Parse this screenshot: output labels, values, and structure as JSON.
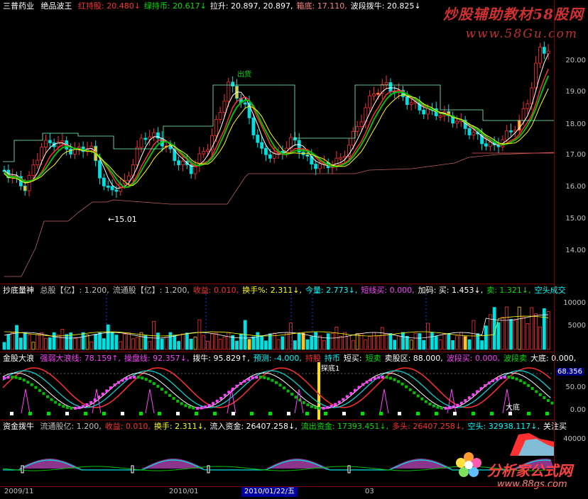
{
  "main_header": {
    "stock": "三普药业",
    "indicator": "绝品波王",
    "items": [
      {
        "label": "红持股:",
        "value": "20.480",
        "arrow": "↓",
        "color": "#ff3030"
      },
      {
        "label": "绿持币:",
        "value": "20.617",
        "arrow": "↓",
        "color": "#00e000"
      },
      {
        "label": "拉升:",
        "value": "20.897, 20.897,",
        "arrow": "",
        "color": "#ffffff"
      },
      {
        "label": "箱底:",
        "value": "17.110,",
        "arrow": "",
        "color": "#ff8080"
      },
      {
        "label": "波段拨牛:",
        "value": "20.825",
        "arrow": "↓",
        "color": "#ffffff"
      }
    ]
  },
  "main_axis": [
    "20.00",
    "19.00",
    "18.00",
    "17.00",
    "16.00",
    "15.00",
    "14.00"
  ],
  "main_annotations": {
    "low": "←15.01",
    "top": "出货"
  },
  "watermark": {
    "line1": "炒股辅助教材58股网",
    "line2": "www.58Gu.com"
  },
  "vol_header": {
    "name": "抄底量神",
    "items": [
      {
        "text": "总股【亿】: 1.200,",
        "color": "#c0c0c0"
      },
      {
        "text": "流通股【亿】: 1.200,",
        "color": "#c0c0c0"
      },
      {
        "text": "收益: 0.010,",
        "color": "#ff3030"
      },
      {
        "text": "换手%: 2.311↓,",
        "color": "#ffff00"
      },
      {
        "text": "今量: 2.773↓,",
        "color": "#00ffff"
      },
      {
        "text": "短线买: 0.000,",
        "color": "#ff40ff"
      },
      {
        "text": "加码: 买: 1.453↓,",
        "color": "#ffffff"
      },
      {
        "text": "卖: 1.321↓,",
        "color": "#00e000"
      },
      {
        "text": "空头成交",
        "color": "#00ffff"
      }
    ]
  },
  "vol_axis": [
    "10000",
    "5000"
  ],
  "osc_header": {
    "name": "金股大浪",
    "items": [
      {
        "text": "强弱大浪线: 78.159↑,",
        "color": "#ff40ff"
      },
      {
        "text": "操盘线: 92.357↓,",
        "color": "#ff40ff"
      },
      {
        "text": "拨牛: 95.829↑,",
        "color": "#ffffff"
      },
      {
        "text": "预测: -4.000,",
        "color": "#00ffff"
      },
      {
        "text": "持股",
        "color": "#ff3030"
      },
      {
        "text": "持币",
        "color": "#00ffff"
      },
      {
        "text": "短买:",
        "color": "#ffffff"
      },
      {
        "text": "短卖",
        "color": "#00e000"
      },
      {
        "text": "卖股区: 88.000,",
        "color": "#ffffff"
      },
      {
        "text": "波段买: 0.000,",
        "color": "#ff40ff"
      },
      {
        "text": "波段卖",
        "color": "#00e000"
      },
      {
        "text": "大底: 0.000,",
        "color": "#ffffff"
      }
    ]
  },
  "osc_axis": {
    "value": "68.356",
    "ticks": [
      "50.00",
      "0.00"
    ]
  },
  "osc_annotations": {
    "probe": "探底1",
    "bottom": "大底"
  },
  "fund_header": {
    "name": "资金拨牛",
    "items": [
      {
        "text": "流通股亿: 1.200,",
        "color": "#c0c0c0"
      },
      {
        "text": "收益: 0.010,",
        "color": "#ff3030"
      },
      {
        "text": "换手: 2.311↓,",
        "color": "#ffff00"
      },
      {
        "text": "流入资金: 26407.258↓,",
        "color": "#ffffff"
      },
      {
        "text": "流出资金: 17393.451↓,",
        "color": "#00e000"
      },
      {
        "text": "多头: 26407.258↓,",
        "color": "#ff3030"
      },
      {
        "text": "空头: 32938.117↓,",
        "color": "#00ffff"
      },
      {
        "text": "关注买",
        "color": "#ffffff"
      }
    ]
  },
  "fund_axis": [
    "40000"
  ],
  "logo": {
    "text": "分析家公式网",
    "url": "www.88gs.com"
  },
  "dates": {
    "d1": "2009/11",
    "d2": "2010/01",
    "selected": "2010/01/22/五",
    "d3": "03"
  }
}
